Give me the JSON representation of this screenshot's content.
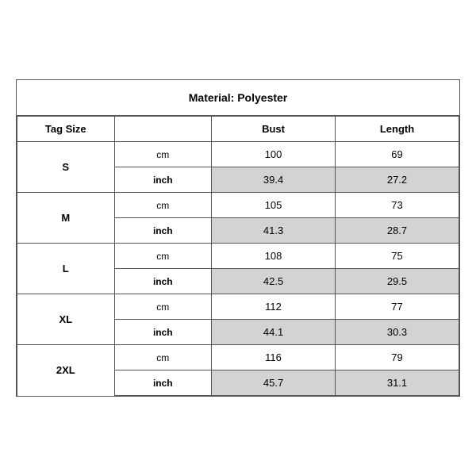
{
  "title": "Material: Polyester",
  "headers": {
    "tag_size": "Tag Size",
    "bust": "Bust",
    "length": "Length"
  },
  "sizes": [
    {
      "tag": "S",
      "cm_bust": "100",
      "cm_length": "69",
      "inch_bust": "39.4",
      "inch_length": "27.2"
    },
    {
      "tag": "M",
      "cm_bust": "105",
      "cm_length": "73",
      "inch_bust": "41.3",
      "inch_length": "28.7"
    },
    {
      "tag": "L",
      "cm_bust": "108",
      "cm_length": "75",
      "inch_bust": "42.5",
      "inch_length": "29.5"
    },
    {
      "tag": "XL",
      "cm_bust": "112",
      "cm_length": "77",
      "inch_bust": "44.1",
      "inch_length": "30.3"
    },
    {
      "tag": "2XL",
      "cm_bust": "116",
      "cm_length": "79",
      "inch_bust": "45.7",
      "inch_length": "31.1"
    }
  ],
  "units": {
    "cm": "cm",
    "inch": "inch"
  }
}
